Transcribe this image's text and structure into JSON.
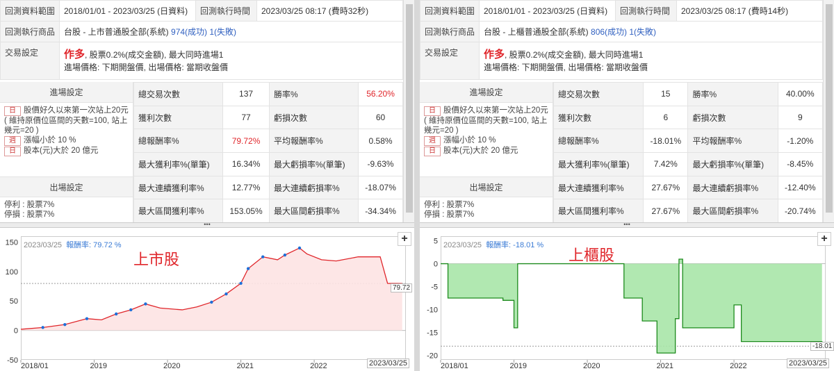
{
  "labels": {
    "range": "回測資料範圍",
    "exec_time": "回測執行時間",
    "product": "回測執行商品",
    "trade": "交易設定",
    "entry": "進場設定",
    "exit": "出場設定"
  },
  "panels": [
    {
      "range_value": "2018/01/01 - 2023/03/25 (日資料)",
      "exec_value": "2023/03/25 08:17 (費時32秒)",
      "product_name": "台股 - 上市普通股全部(系統)",
      "success": "974(成功)",
      "failed": "1(失敗)",
      "direction": "作多",
      "trade_desc": ", 股票0.2%(成交金額), 最大同時進場1",
      "trade_desc2": "進場價格: 下期開盤價, 出場價格: 當期收盤價",
      "cond1_tag": "日",
      "cond1": "股價好久以來第一次站上20元( 維持原價位區間的天數=100, 站上幾元=20 )",
      "cond2_tag": "週",
      "cond2": "漲幅小於 10 %",
      "cond3_tag": "日",
      "cond3": "股本(元)大於 20 億元",
      "exit1": "停利 : 股票7%",
      "exit2": "停損 : 股票7%",
      "stats": [
        [
          "總交易次數",
          "137",
          "勝率%",
          "56.20%"
        ],
        [
          "獲利次數",
          "77",
          "虧損次數",
          "60"
        ],
        [
          "總報酬率%",
          "79.72%",
          "平均報酬率%",
          "0.58%"
        ],
        [
          "最大獲利率%(單筆)",
          "16.34%",
          "最大虧損率%(單筆)",
          "-9.63%"
        ],
        [
          "最大連續獲利率%",
          "12.77%",
          "最大連續虧損率%",
          "-18.07%"
        ],
        [
          "最大區間獲利率%",
          "153.05%",
          "最大區間虧損率%",
          "-34.34%"
        ]
      ],
      "chart_date": "2023/03/25",
      "chart_rate_label": "報酬率: 79.72 %",
      "chart_title": "上市股",
      "end_value": "79.72",
      "end_date": "2023/03/25"
    },
    {
      "range_value": "2018/01/01 - 2023/03/25 (日資料)",
      "exec_value": "2023/03/25 08:17 (費時14秒)",
      "product_name": "台股 - 上櫃普通股全部(系統)",
      "success": "806(成功)",
      "failed": "1(失敗)",
      "direction": "作多",
      "trade_desc": ", 股票0.2%(成交金額), 最大同時進場1",
      "trade_desc2": "進場價格: 下期開盤價, 出場價格: 當期收盤價",
      "cond1_tag": "日",
      "cond1": "股價好久以來第一次站上20元( 維持原價位區間的天數=100, 站上幾元=20 )",
      "cond2_tag": "週",
      "cond2": "漲幅小於 10 %",
      "cond3_tag": "日",
      "cond3": "股本(元)大於 20 億元",
      "exit1": "停利 : 股票7%",
      "exit2": "停損 : 股票7%",
      "stats": [
        [
          "總交易次數",
          "15",
          "勝率%",
          "40.00%"
        ],
        [
          "獲利次數",
          "6",
          "虧損次數",
          "9"
        ],
        [
          "總報酬率%",
          "-18.01%",
          "平均報酬率%",
          "-1.20%"
        ],
        [
          "最大獲利率%(單筆)",
          "7.42%",
          "最大虧損率%(單筆)",
          "-8.45%"
        ],
        [
          "最大連續獲利率%",
          "27.67%",
          "最大連續虧損率%",
          "-12.40%"
        ],
        [
          "最大區間獲利率%",
          "27.67%",
          "最大區間虧損率%",
          "-20.74%"
        ]
      ],
      "chart_date": "2023/03/25",
      "chart_rate_label": "報酬率: -18.01 %",
      "chart_title": "上櫃股",
      "end_value": "-18.01",
      "end_date": "2023/03/25"
    }
  ],
  "colors": {
    "accent_red": "#e0262b",
    "link_blue": "#3060c0",
    "line_blue": "#1e6fd9",
    "fill_pink": "#fde3e3",
    "fill_green": "#a8e6a8"
  },
  "chart_data": [
    {
      "type": "area",
      "x_ticks": [
        "2018/01",
        "2019",
        "2020",
        "2021",
        "2022"
      ],
      "y_ticks": [
        "150",
        "100",
        "50",
        "0",
        "-50"
      ],
      "ylim": [
        -50,
        160
      ],
      "x": [
        2018.0,
        2018.3,
        2018.6,
        2018.9,
        2019.1,
        2019.3,
        2019.5,
        2019.7,
        2019.9,
        2020.2,
        2020.4,
        2020.6,
        2020.8,
        2021.0,
        2021.1,
        2021.3,
        2021.5,
        2021.6,
        2021.8,
        2021.9,
        2022.1,
        2022.3,
        2022.6,
        2022.9,
        2023.0,
        2023.2
      ],
      "y": [
        2,
        5,
        10,
        20,
        18,
        28,
        35,
        45,
        38,
        35,
        40,
        48,
        62,
        80,
        105,
        125,
        120,
        128,
        140,
        130,
        120,
        118,
        125,
        125,
        80,
        79.72
      ],
      "final": 79.72
    },
    {
      "type": "area",
      "x_ticks": [
        "2018/01",
        "2019",
        "2020",
        "2021",
        "2022"
      ],
      "y_ticks": [
        "5",
        "0",
        "-5",
        "-10",
        "-15",
        "-20"
      ],
      "ylim": [
        -21,
        6
      ],
      "x": [
        2018.0,
        2018.1,
        2018.6,
        2018.85,
        2019.0,
        2019.05,
        2020.25,
        2020.5,
        2020.75,
        2020.95,
        2021.2,
        2021.25,
        2021.3,
        2021.7,
        2022.0,
        2022.1,
        2023.0,
        2023.2
      ],
      "y": [
        0,
        -7.5,
        -7.5,
        -8,
        -14,
        0,
        0,
        -7.5,
        -12.5,
        -19.5,
        -12,
        1,
        -14,
        -14,
        -9,
        -17,
        -17,
        -18.01
      ],
      "final": -18.01
    }
  ]
}
